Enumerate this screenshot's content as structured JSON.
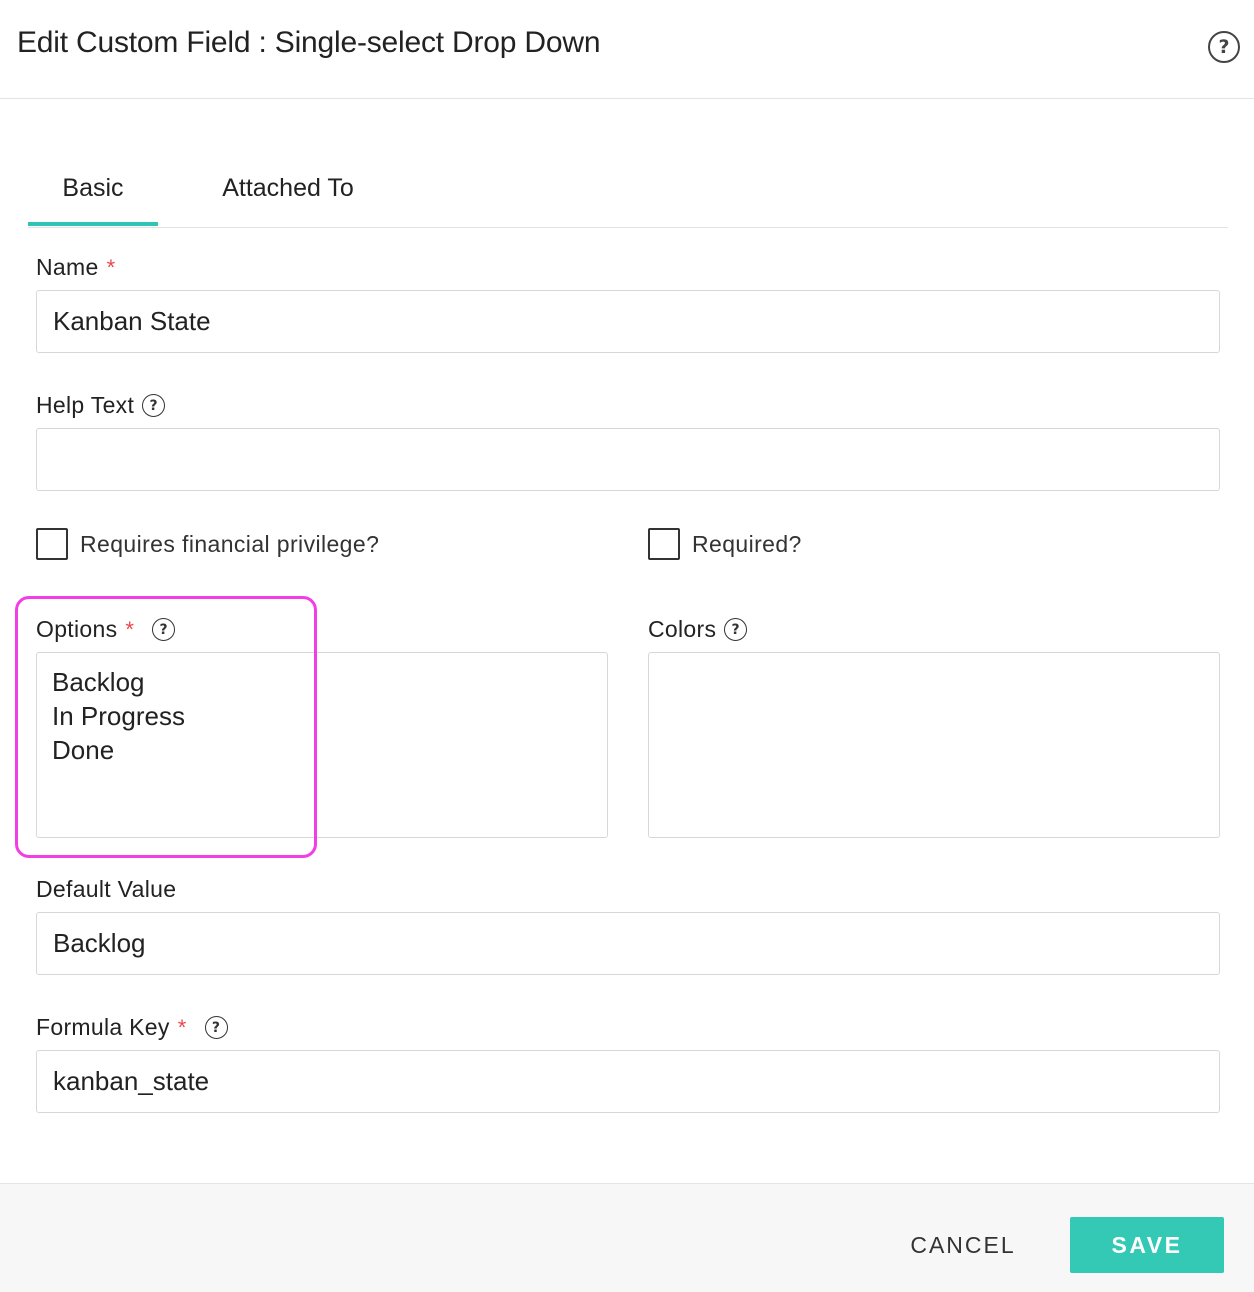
{
  "dialog": {
    "title": "Edit Custom Field : Single-select Drop Down",
    "help_icon": "question-circle-icon"
  },
  "tabs": [
    {
      "label": "Basic",
      "active": true
    },
    {
      "label": "Attached To",
      "active": false
    }
  ],
  "accent_color": "#2ec4b6",
  "highlight_color": "#f23ee6",
  "required_color": "#e8484d",
  "fields": {
    "name": {
      "label": "Name",
      "required_mark": "*",
      "value": "Kanban State"
    },
    "help_text": {
      "label": "Help Text",
      "value": ""
    },
    "requires_financial": {
      "label": "Requires financial privilege?",
      "checked": false
    },
    "required": {
      "label": "Required?",
      "checked": false
    },
    "options": {
      "label": "Options",
      "required_mark": "*",
      "lines": [
        "Backlog",
        "In Progress",
        "Done"
      ]
    },
    "colors": {
      "label": "Colors",
      "value": ""
    },
    "default_value": {
      "label": "Default Value",
      "value": "Backlog"
    },
    "formula_key": {
      "label": "Formula Key",
      "required_mark": "*",
      "value": "kanban_state"
    }
  },
  "footer": {
    "cancel_label": "CANCEL",
    "save_label": "SAVE",
    "save_color": "#33c9b4"
  }
}
